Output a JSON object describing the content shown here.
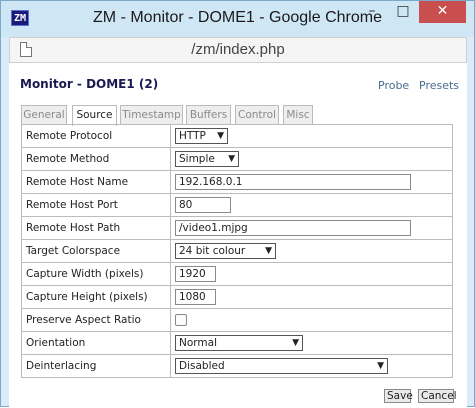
{
  "window": {
    "icon_text": "ZM",
    "title": "ZM - Monitor - DOME1 - Google Chrome",
    "min_label": "–",
    "max_label": "□",
    "close_label": "✕",
    "accent_close": "#c94f4f"
  },
  "urlbar": {
    "url": "/zm/index.php"
  },
  "header": {
    "title": "Monitor - DOME1 (2)",
    "probe_label": "Probe",
    "presets_label": "Presets"
  },
  "tabs": [
    {
      "label": "General",
      "active": false
    },
    {
      "label": "Source",
      "active": true
    },
    {
      "label": "Timestamp",
      "active": false
    },
    {
      "label": "Buffers",
      "active": false
    },
    {
      "label": "Control",
      "active": false
    },
    {
      "label": "Misc",
      "active": false
    }
  ],
  "fields": [
    {
      "label": "Remote Protocol",
      "type": "select",
      "value": "HTTP"
    },
    {
      "label": "Remote Method",
      "type": "select",
      "value": "Simple"
    },
    {
      "label": "Remote Host Name",
      "type": "text",
      "value": "192.168.0.1"
    },
    {
      "label": "Remote Host Port",
      "type": "text",
      "value": "80"
    },
    {
      "label": "Remote Host Path",
      "type": "text",
      "value": "/video1.mjpg"
    },
    {
      "label": "Target Colorspace",
      "type": "select",
      "value": "24 bit colour"
    },
    {
      "label": "Capture Width (pixels)",
      "type": "text",
      "value": "1920"
    },
    {
      "label": "Capture Height (pixels)",
      "type": "text",
      "value": "1080"
    },
    {
      "label": "Preserve Aspect Ratio",
      "type": "checkbox",
      "value": ""
    },
    {
      "label": "Orientation",
      "type": "select",
      "value": "Normal"
    },
    {
      "label": "Deinterlacing",
      "type": "select",
      "value": "Disabled"
    }
  ],
  "buttons": {
    "save_label": "Save",
    "cancel_label": "Cancel"
  }
}
